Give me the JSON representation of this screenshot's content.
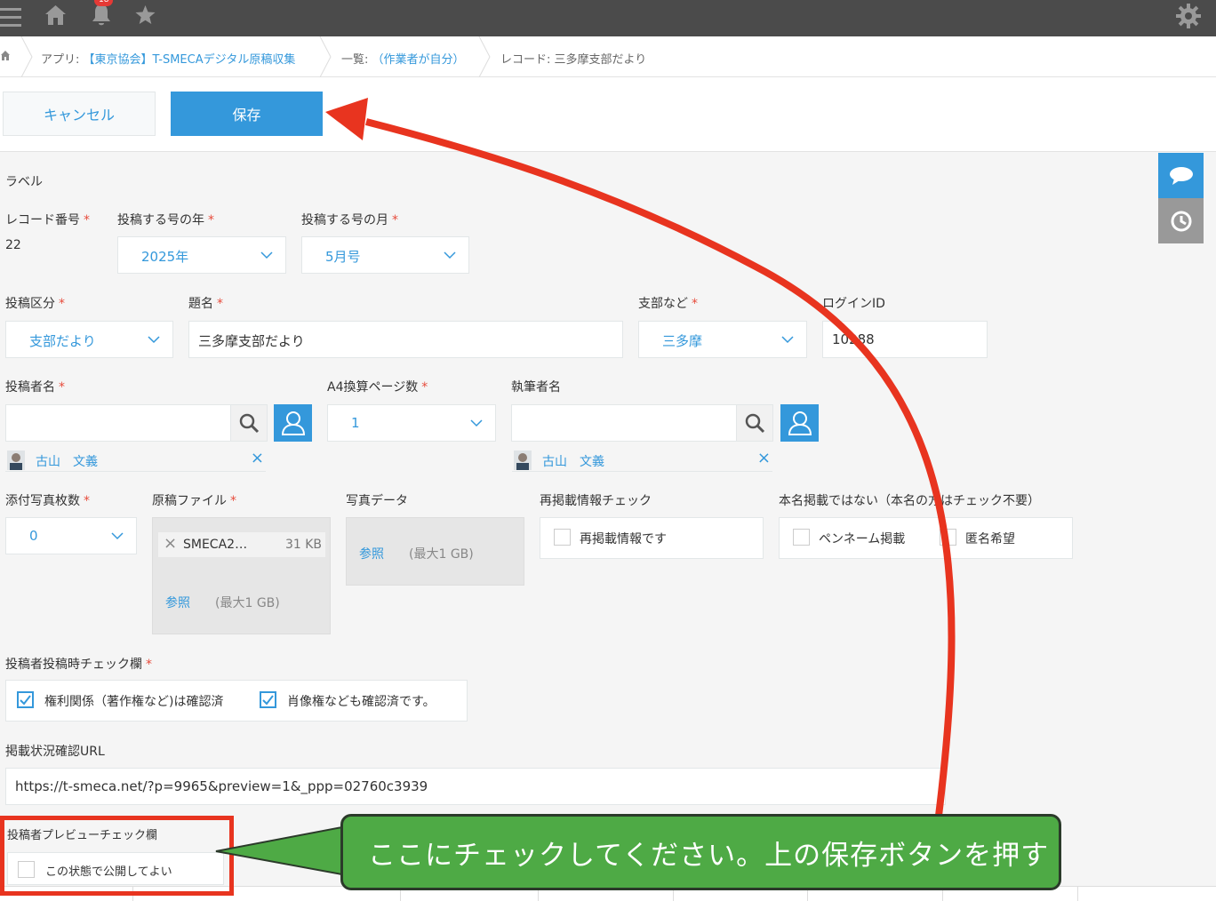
{
  "topbar": {
    "notification_count": "18",
    "icons": [
      "menu-icon",
      "home-icon",
      "bell-icon",
      "star-icon",
      "gear-icon"
    ]
  },
  "breadcrumb": {
    "app_prefix": "アプリ: ",
    "app_name": "【東京協会】T-SMECAデジタル原稿収集",
    "list_prefix": "一覧: ",
    "list_name": "（作業者が自分）",
    "record": "レコード: 三多摩支部だより"
  },
  "actions": {
    "cancel": "キャンセル",
    "save": "保存"
  },
  "form": {
    "label_section": "ラベル",
    "record_no_label": "レコード番号",
    "record_no_value": "22",
    "year_label": "投稿する号の年",
    "year_value": "2025年",
    "month_label": "投稿する号の月",
    "month_value": "5月号",
    "category_label": "投稿区分",
    "category_value": "支部だより",
    "title_label": "題名",
    "title_value": "三多摩支部だより",
    "branch_label": "支部など",
    "branch_value": "三多摩",
    "login_label": "ログインID",
    "login_value": "10288",
    "submitter_label": "投稿者名",
    "submitter_chip": "古山　文義",
    "pages_label": "A4換算ページ数",
    "pages_value": "1",
    "author_label": "執筆者名",
    "author_chip": "古山　文義",
    "photos_label": "添付写真枚数",
    "photos_value": "0",
    "manuscript_label": "原稿ファイル",
    "manuscript_file": "SMECA2…",
    "manuscript_size": "31 KB",
    "browse": "参照",
    "max_size": "(最大1 GB)",
    "photo_data_label": "写真データ",
    "repost_label": "再掲載情報チェック",
    "repost_option": "再掲載情報です",
    "realname_label": "本名掲載ではない（本名の方はチェック不要）",
    "realname_opt1": "ペンネーム掲載",
    "realname_opt2": "匿名希望",
    "check_label": "投稿者投稿時チェック欄",
    "check_opt1": "権利関係（著作権など)は確認済",
    "check_opt2": "肖像権なども確認済です。",
    "url_label": "掲載状況確認URL",
    "url_value": "https://t-smeca.net/?p=9965&preview=1&_ppp=02760c3939",
    "preview_label": "投稿者プレビューチェック欄",
    "preview_option": "この状態で公開してよい"
  },
  "annotation": {
    "callout": "ここにチェックしてください。上の保存ボタンを押す",
    "arrow_color": "#e8341f",
    "callout_color": "#4eaa45"
  },
  "colors": {
    "accent": "#3498db",
    "required": "#e74c3c",
    "topbar": "#4b4b4b"
  }
}
